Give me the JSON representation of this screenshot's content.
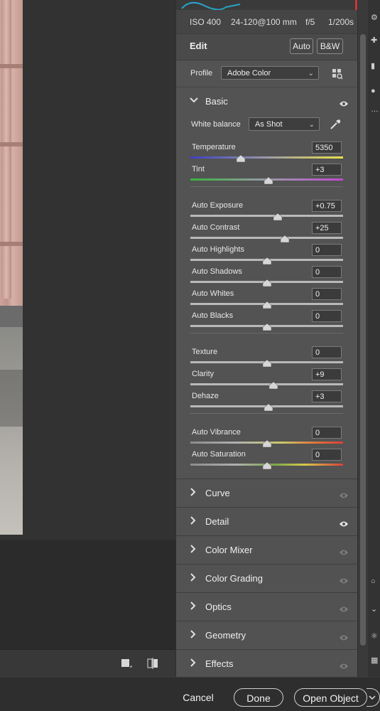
{
  "meta": {
    "iso": "ISO 400",
    "lens": "24-120@100 mm",
    "aperture": "f/5",
    "shutter": "1/200s"
  },
  "edit": {
    "title": "Edit",
    "auto_label": "Auto",
    "bw_label": "B&W"
  },
  "profile": {
    "label": "Profile",
    "value": "Adobe Color",
    "browse_icon": "grid-browse-icon"
  },
  "basic": {
    "title": "Basic",
    "white_balance": {
      "label": "White balance",
      "value": "As Shot",
      "picker_icon": "eyedropper-icon"
    },
    "groups": [
      {
        "sliders": [
          {
            "label": "Temperature",
            "value": "5350",
            "position": 0.33,
            "track": "temperature"
          },
          {
            "label": "Tint",
            "value": "+3",
            "position": 0.51,
            "track": "tint"
          }
        ]
      },
      {
        "sliders": [
          {
            "label": "Auto Exposure",
            "value": "+0.75",
            "position": 0.57,
            "track": "gray"
          },
          {
            "label": "Auto Contrast",
            "value": "+25",
            "position": 0.62,
            "track": "gray"
          },
          {
            "label": "Auto Highlights",
            "value": "0",
            "position": 0.5,
            "track": "gray"
          },
          {
            "label": "Auto Shadows",
            "value": "0",
            "position": 0.5,
            "track": "gray"
          },
          {
            "label": "Auto Whites",
            "value": "0",
            "position": 0.5,
            "track": "gray"
          },
          {
            "label": "Auto Blacks",
            "value": "0",
            "position": 0.5,
            "track": "gray"
          }
        ]
      },
      {
        "sliders": [
          {
            "label": "Texture",
            "value": "0",
            "position": 0.5,
            "track": "gray"
          },
          {
            "label": "Clarity",
            "value": "+9",
            "position": 0.545,
            "track": "gray"
          },
          {
            "label": "Dehaze",
            "value": "+3",
            "position": 0.51,
            "track": "gray"
          }
        ]
      },
      {
        "sliders": [
          {
            "label": "Auto Vibrance",
            "value": "0",
            "position": 0.5,
            "track": "vibrance"
          },
          {
            "label": "Auto Saturation",
            "value": "0",
            "position": 0.5,
            "track": "saturation"
          }
        ]
      }
    ]
  },
  "sections": [
    {
      "title": "Curve",
      "eye_active": false
    },
    {
      "title": "Detail",
      "eye_active": true
    },
    {
      "title": "Color Mixer",
      "eye_active": false
    },
    {
      "title": "Color Grading",
      "eye_active": false
    },
    {
      "title": "Optics",
      "eye_active": false
    },
    {
      "title": "Geometry",
      "eye_active": false
    },
    {
      "title": "Effects",
      "eye_active": false
    }
  ],
  "footer": {
    "cancel": "Cancel",
    "done": "Done",
    "open_object": "Open Object"
  },
  "colors": {
    "accent_blue": "#2f6fd6",
    "panel_bg": "#535353"
  }
}
